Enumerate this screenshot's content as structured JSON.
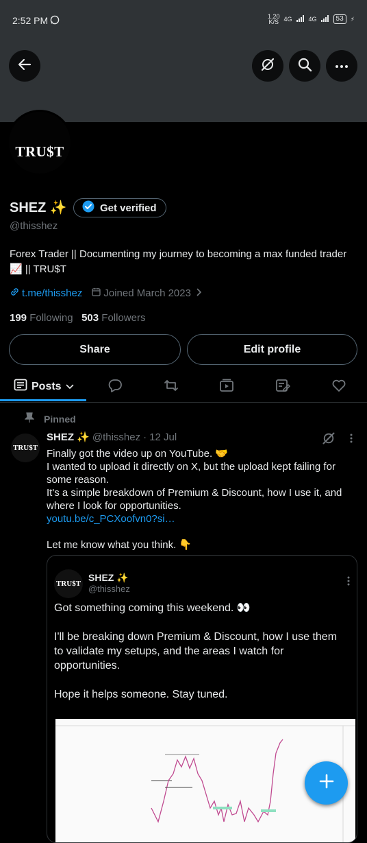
{
  "status_bar": {
    "time": "2:52 PM",
    "net_speed": "1.20",
    "net_unit": "K/S",
    "signal1": "4G",
    "signal2": "4G",
    "battery": "53"
  },
  "profile": {
    "avatar_text": "TRU$T",
    "name": "SHEZ ✨",
    "get_verified_label": "Get verified",
    "handle": "@thisshez",
    "bio": "Forex Trader || Documenting my journey to becoming a max funded trader 📈 || TRU$T",
    "link": "t.me/thisshez",
    "joined": "Joined March 2023",
    "following_count": "199",
    "following_label": "Following",
    "followers_count": "503",
    "followers_label": "Followers",
    "share_label": "Share",
    "edit_profile_label": "Edit profile"
  },
  "tabs": {
    "posts_label": "Posts"
  },
  "pinned_post": {
    "pinned_label": "Pinned",
    "avatar_text": "TRU$T",
    "name": "SHEZ ✨",
    "handle": "@thisshez",
    "separator": "·",
    "date": "12 Jul",
    "line1": "Finally got the video up on YouTube. 🤝",
    "line2": "I wanted to upload it directly on X, but the upload kept failing for some reason.",
    "line3": "It's a simple breakdown of Premium & Discount, how I use it, and where I look for opportunities.",
    "link": "youtu.be/c_PCXoofvn0?si…",
    "line4": "Let me know what you think. 👇"
  },
  "quoted_post": {
    "avatar_text": "TRU$T",
    "name": "SHEZ ✨",
    "handle": "@thisshez",
    "line1": "Got something coming this weekend. 👀",
    "line2": "I'll be breaking down Premium & Discount, how I use them to validate my setups, and the areas I watch for opportunities.",
    "line3": "Hope it helps someone. Stay tuned."
  },
  "colors": {
    "accent": "#1d9bf0",
    "background": "#000000",
    "banner": "#2f3336",
    "secondary_text": "#71767b"
  },
  "icons": [
    "back-arrow-icon",
    "grok-icon",
    "search-icon",
    "more-icon",
    "verified-badge-icon",
    "link-icon",
    "calendar-icon",
    "chevron-right-icon",
    "posts-icon",
    "chevron-down-icon",
    "reply-icon",
    "repost-icon",
    "media-icon",
    "articles-icon",
    "like-icon",
    "pin-icon",
    "compose-plus-icon"
  ]
}
